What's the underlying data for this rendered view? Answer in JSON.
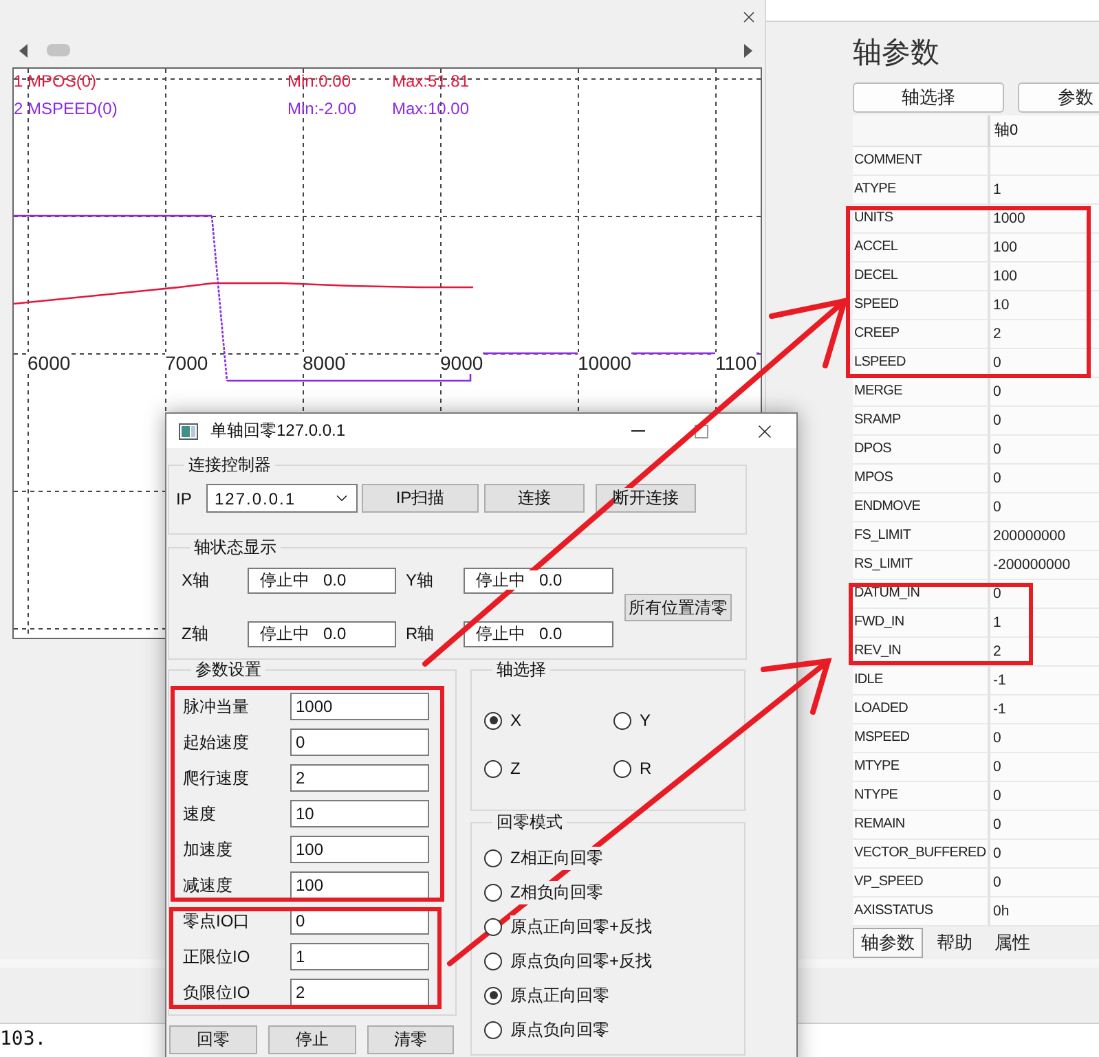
{
  "scope": {
    "legend": [
      {
        "label": "1 MPOS(0)",
        "min": "Min:0.00",
        "max": "Max:51.81",
        "color": "#e3173c"
      },
      {
        "label": "2 MSPEED(0)",
        "min": "Min:-2.00",
        "max": "Max:10.00",
        "color": "#8a2be2"
      }
    ],
    "x_labels": [
      "6000",
      "7000",
      "8000",
      "9000",
      "10000",
      "1100"
    ]
  },
  "axis_panel": {
    "title": "轴参数",
    "buttons": [
      "轴选择",
      "参数"
    ],
    "header": "轴0",
    "rows": [
      {
        "name": "COMMENT"
      },
      {
        "name": "ATYPE",
        "value": "1"
      },
      {
        "name": "UNITS",
        "value": "1000"
      },
      {
        "name": "ACCEL",
        "value": "100"
      },
      {
        "name": "DECEL",
        "value": "100"
      },
      {
        "name": "SPEED",
        "value": "10"
      },
      {
        "name": "CREEP",
        "value": "2"
      },
      {
        "name": "LSPEED",
        "value": "0"
      },
      {
        "name": "MERGE",
        "value": "0"
      },
      {
        "name": "SRAMP",
        "value": "0"
      },
      {
        "name": "DPOS",
        "value": "0"
      },
      {
        "name": "MPOS",
        "value": "0"
      },
      {
        "name": "ENDMOVE",
        "value": "0"
      },
      {
        "name": "FS_LIMIT",
        "value": "200000000"
      },
      {
        "name": "RS_LIMIT",
        "value": "-200000000"
      },
      {
        "name": "DATUM_IN",
        "value": "0"
      },
      {
        "name": "FWD_IN",
        "value": "1"
      },
      {
        "name": "REV_IN",
        "value": "2"
      },
      {
        "name": "IDLE",
        "value": "-1"
      },
      {
        "name": "LOADED",
        "value": "-1"
      },
      {
        "name": "MSPEED",
        "value": "0"
      },
      {
        "name": "MTYPE",
        "value": "0"
      },
      {
        "name": "NTYPE",
        "value": "0"
      },
      {
        "name": "REMAIN",
        "value": "0"
      },
      {
        "name": "VECTOR_BUFFERED",
        "value": "0"
      },
      {
        "name": "VP_SPEED",
        "value": "0"
      },
      {
        "name": "AXISSTATUS",
        "value": "0h"
      }
    ],
    "tabs": [
      {
        "label": "轴参数",
        "selected": true
      },
      {
        "label": "帮助",
        "selected": false
      },
      {
        "label": "属性",
        "selected": false
      }
    ]
  },
  "dialog": {
    "title": "单轴回零127.0.0.1",
    "connection": {
      "title": "连接控制器",
      "ip_label": "IP",
      "ip_value": "127.0.0.1",
      "buttons": [
        "IP扫描",
        "连接",
        "断开连接"
      ]
    },
    "axis_status": {
      "title": "轴状态显示",
      "axes": [
        {
          "label": "X轴",
          "status": "停止中   0.0"
        },
        {
          "label": "Y轴",
          "status": "停止中   0.0"
        },
        {
          "label": "Z轴",
          "status": "停止中   0.0"
        },
        {
          "label": "R轴",
          "status": "停止中   0.0"
        }
      ],
      "clear_button": "所有位置清零"
    },
    "params": {
      "title": "参数设置",
      "fields": [
        {
          "label": "脉冲当量",
          "value": "1000"
        },
        {
          "label": "起始速度",
          "value": "0"
        },
        {
          "label": "爬行速度",
          "value": "2"
        },
        {
          "label": "速度",
          "value": "10"
        },
        {
          "label": "加速度",
          "value": "100"
        },
        {
          "label": "减速度",
          "value": "100"
        },
        {
          "label": "零点IO口",
          "value": "0"
        },
        {
          "label": "正限位IO",
          "value": "1"
        },
        {
          "label": "负限位IO",
          "value": "2"
        }
      ]
    },
    "axis_select": {
      "title": "轴选择",
      "options": [
        {
          "label": "X",
          "selected": true
        },
        {
          "label": "Y",
          "selected": false
        },
        {
          "label": "Z",
          "selected": false
        },
        {
          "label": "R",
          "selected": false
        }
      ]
    },
    "home_mode": {
      "title": "回零模式",
      "options": [
        {
          "label": "Z相正向回零",
          "selected": false
        },
        {
          "label": "Z相负向回零",
          "selected": false
        },
        {
          "label": "原点正向回零+反找",
          "selected": false
        },
        {
          "label": "原点负向回零+反找",
          "selected": false
        },
        {
          "label": "原点正向回零",
          "selected": true
        },
        {
          "label": "原点负向回零",
          "selected": false
        }
      ]
    },
    "buttons": [
      "回零",
      "停止",
      "清零"
    ]
  },
  "console": {
    "text": "103."
  }
}
